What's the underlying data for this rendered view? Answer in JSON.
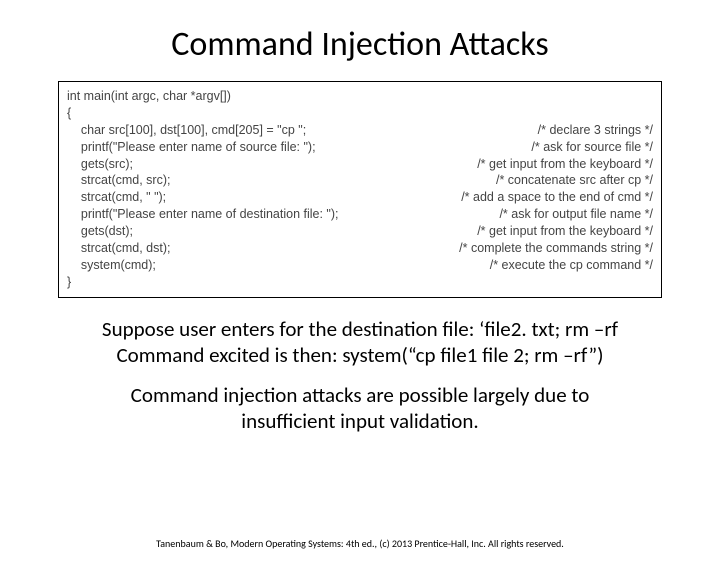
{
  "title": "Command Injection Attacks",
  "code": {
    "lines": [
      {
        "left": "int main(int argc, char *argv[])",
        "right": ""
      },
      {
        "left": "{",
        "right": ""
      },
      {
        "left": "    char src[100], dst[100], cmd[205] = \"cp \";",
        "right": "/* declare 3 strings */"
      },
      {
        "left": "    printf(\"Please enter name of source file: \");",
        "right": "/* ask for source file */"
      },
      {
        "left": "    gets(src);",
        "right": "/* get input from the keyboard */"
      },
      {
        "left": "    strcat(cmd, src);",
        "right": "/* concatenate src after cp */"
      },
      {
        "left": "    strcat(cmd, \" \");",
        "right": "/* add a space to the end of cmd */"
      },
      {
        "left": "    printf(\"Please enter name of destination file: \");",
        "right": "/* ask for output file name */"
      },
      {
        "left": "    gets(dst);",
        "right": "/* get input from the keyboard */"
      },
      {
        "left": "    strcat(cmd, dst);",
        "right": "/* complete the commands string */"
      },
      {
        "left": "    system(cmd);",
        "right": "/* execute the cp command */"
      },
      {
        "left": "}",
        "right": ""
      }
    ]
  },
  "para1_line1": "Suppose user enters for the destination file: ‘file2. txt; rm –rf",
  "para1_line2": "Command excited is then: system(“cp file1 file 2; rm –rf”)",
  "para2_line1": "Command injection attacks are possible largely due to",
  "para2_line2": "insufficient input validation.",
  "footer": "Tanenbaum & Bo, Modern Operating Systems: 4th ed., (c) 2013 Prentice-Hall, Inc. All rights reserved."
}
